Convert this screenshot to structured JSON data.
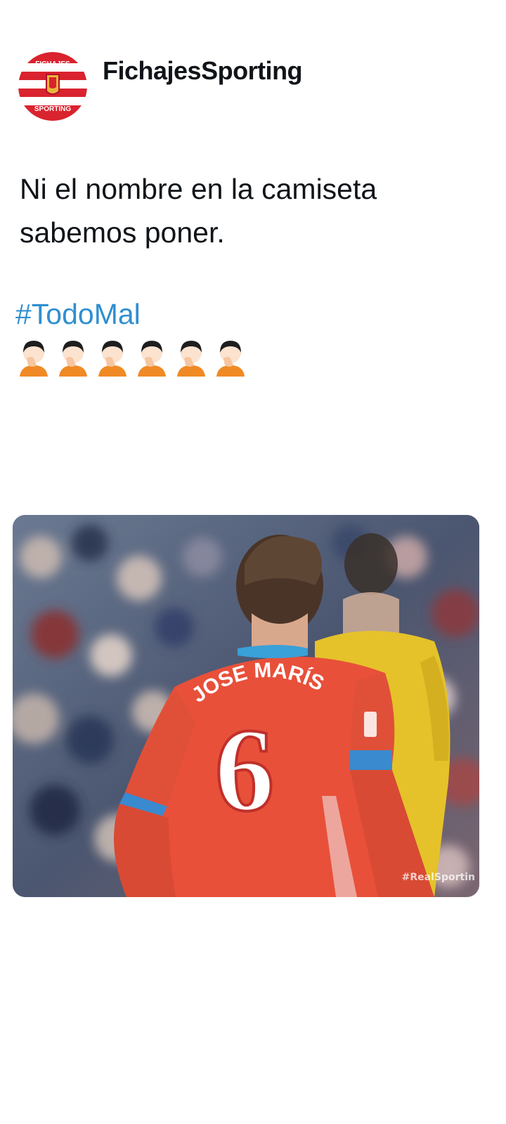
{
  "tweet": {
    "author": {
      "display_name": "FichajesSporting",
      "avatar_text_top": "FICHAJES",
      "avatar_text_bottom": "SPORTING"
    },
    "text_lines": [
      "Ni el nombre en la camiseta",
      "sabemos poner."
    ],
    "hashtag": "#TodoMal",
    "emojis": [
      "face-palm-emoji",
      "face-palm-emoji",
      "face-palm-emoji",
      "face-palm-emoji",
      "face-palm-emoji",
      "face-palm-emoji"
    ]
  },
  "media": {
    "shirt_name": "JOSE MARÍS",
    "shirt_number": "6",
    "watermark": "#RealSportin"
  },
  "colors": {
    "hashtag": "#2f8fd0",
    "club_red": "#d9232e",
    "shirt_red": "#e8503a"
  }
}
